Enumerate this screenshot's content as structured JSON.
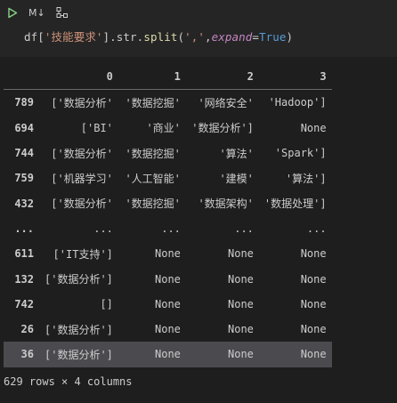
{
  "toolbar": {
    "run_icon": "play-icon",
    "markdown_label": "M↓",
    "variables_icon": "variables-icon"
  },
  "code": {
    "df": "df[",
    "key": "'技能要求'",
    "attr": "].str.",
    "fn": "split",
    "open": "(",
    "sep": "','",
    "comma": ",",
    "kwarg": "expand",
    "eq": "=",
    "value": "True",
    "close": ")"
  },
  "output": {
    "columns": [
      "",
      "0",
      "1",
      "2",
      "3"
    ],
    "rows": [
      {
        "index": "789",
        "cells": [
          "['数据分析'",
          "'数据挖掘'",
          "'网络安全'",
          "'Hadoop']"
        ]
      },
      {
        "index": "694",
        "cells": [
          "['BI'",
          "'商业'",
          "'数据分析']",
          "None"
        ]
      },
      {
        "index": "744",
        "cells": [
          "['数据分析'",
          "'数据挖掘'",
          "'算法'",
          "'Spark']"
        ]
      },
      {
        "index": "759",
        "cells": [
          "['机器学习'",
          "'人工智能'",
          "'建模'",
          "'算法']"
        ]
      },
      {
        "index": "432",
        "cells": [
          "['数据分析'",
          "'数据挖掘'",
          "'数据架构'",
          "'数据处理']"
        ]
      },
      {
        "index": "...",
        "cells": [
          "...",
          "...",
          "...",
          "..."
        ]
      },
      {
        "index": "611",
        "cells": [
          "['IT支持']",
          "None",
          "None",
          "None"
        ]
      },
      {
        "index": "132",
        "cells": [
          "['数据分析']",
          "None",
          "None",
          "None"
        ]
      },
      {
        "index": "742",
        "cells": [
          "[]",
          "None",
          "None",
          "None"
        ]
      },
      {
        "index": "26",
        "cells": [
          "['数据分析']",
          "None",
          "None",
          "None"
        ]
      },
      {
        "index": "36",
        "cells": [
          "['数据分析']",
          "None",
          "None",
          "None"
        ]
      }
    ],
    "highlighted_row": "36",
    "shape": "629 rows × 4 columns"
  },
  "colors": {
    "background": "#1e1e1e",
    "cell_background": "#252526",
    "run_icon": "#89d185",
    "string": "#ce9178",
    "function": "#dcdcaa",
    "keyword_arg": "#c586c0",
    "constant": "#569cd6",
    "highlight_row": "#4a4a4f"
  }
}
